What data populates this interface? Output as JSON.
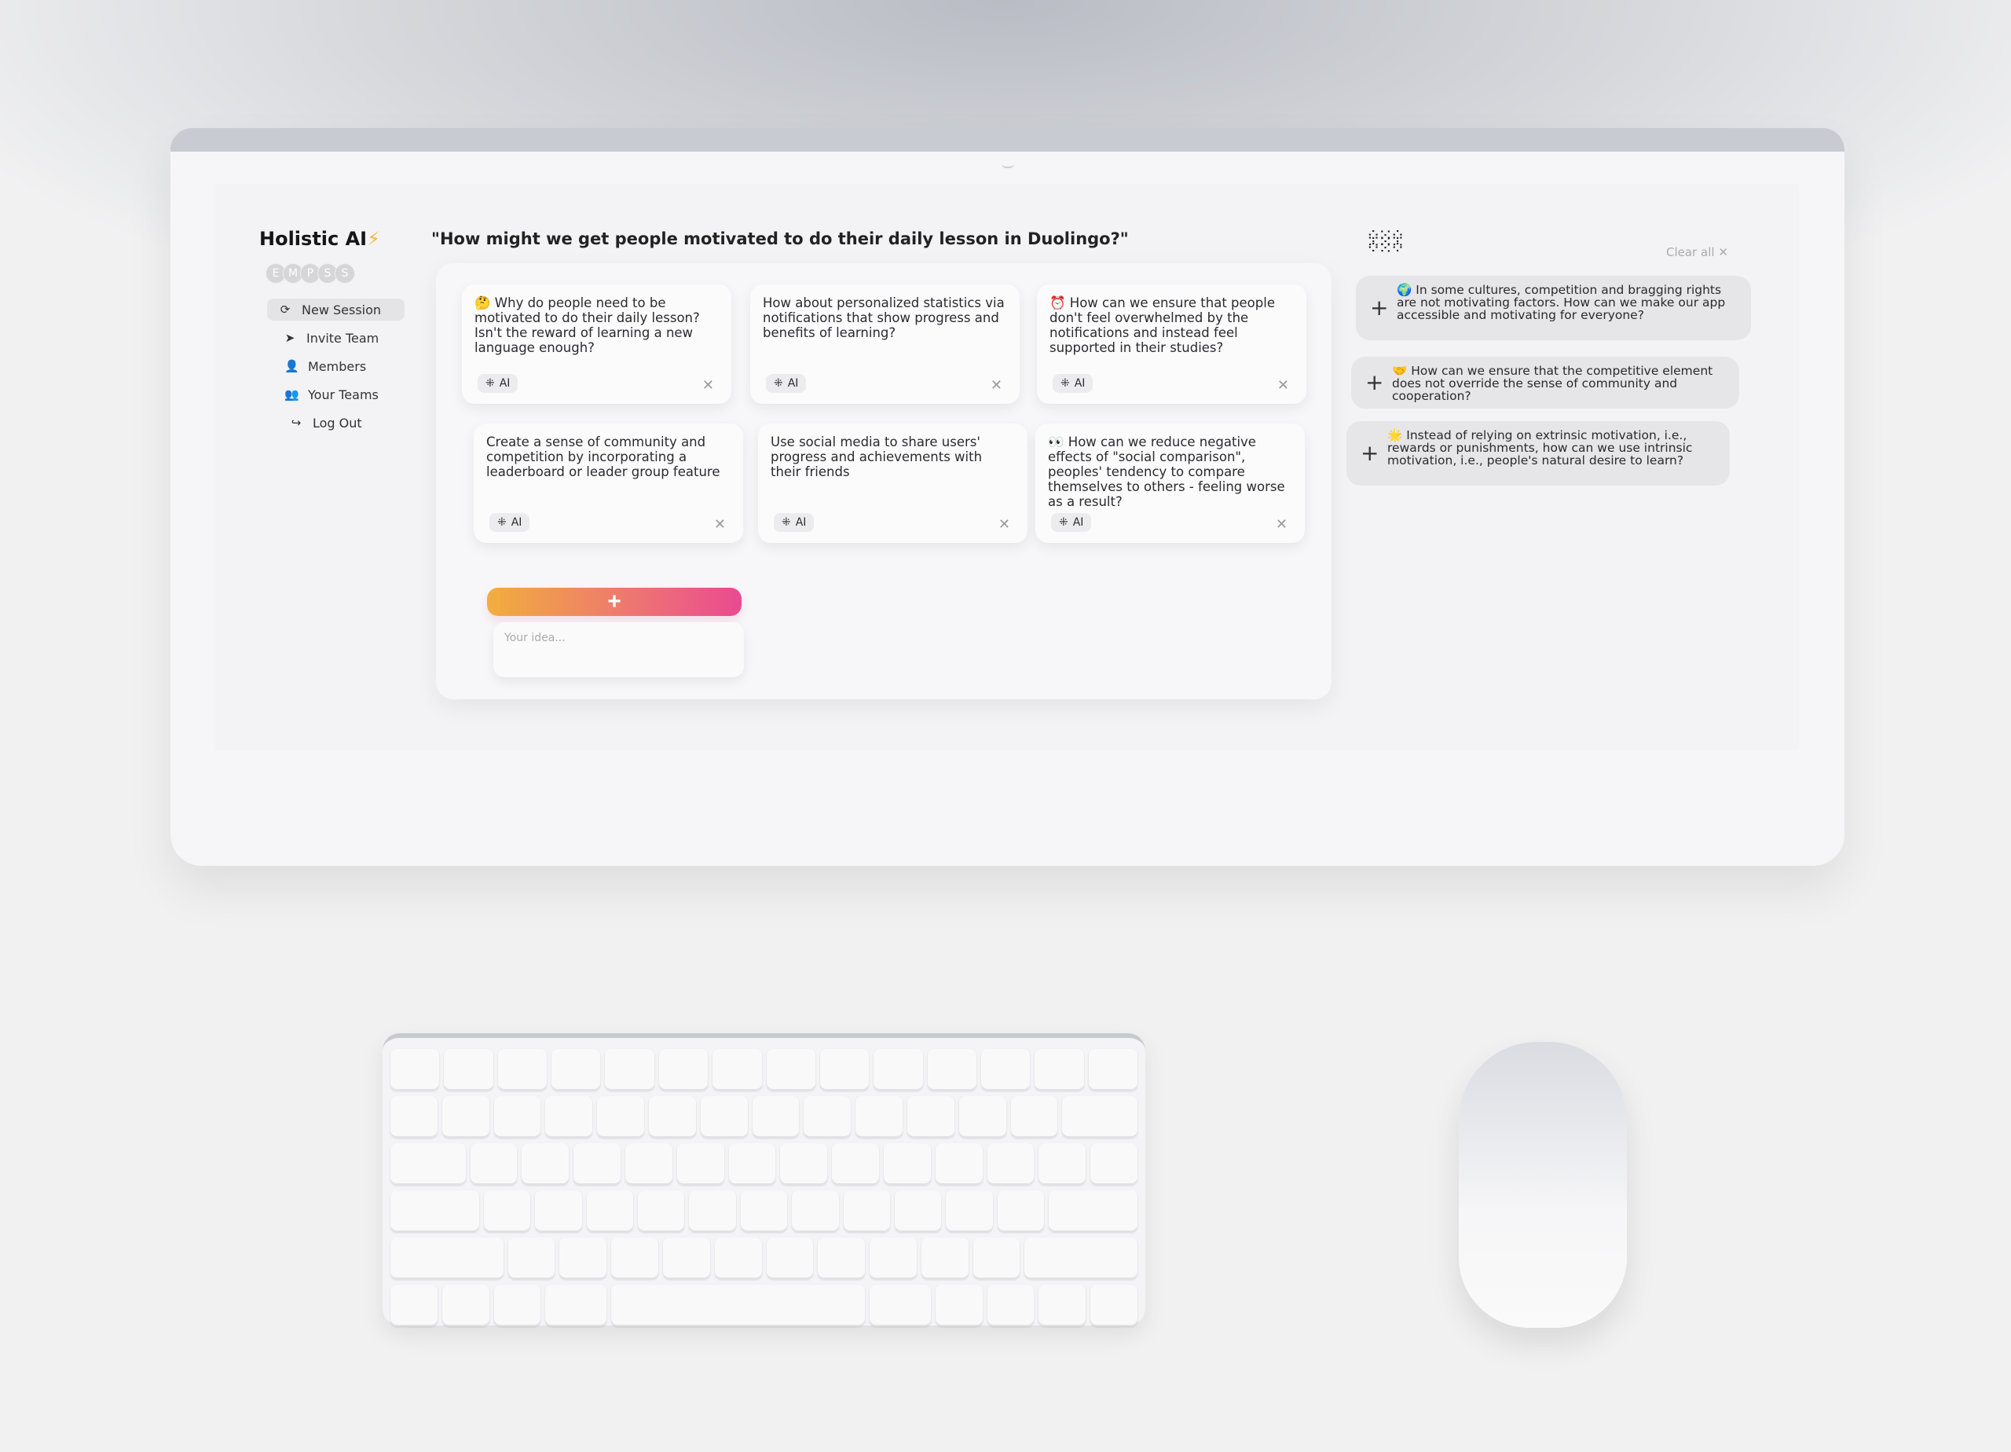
{
  "app": {
    "brand": "Holistic AI",
    "brand_icon": "lightning-bolt",
    "avatars": [
      "E",
      "M",
      "P",
      "S",
      "S"
    ]
  },
  "nav": [
    {
      "label": "New Session",
      "icon": "refresh",
      "active": true
    },
    {
      "label": "Invite Team",
      "icon": "paper-plane"
    },
    {
      "label": "Members",
      "icon": "user"
    },
    {
      "label": "Your Teams",
      "icon": "users"
    },
    {
      "label": "Log Out",
      "icon": "share-arrow"
    }
  ],
  "question": "\"How might we get people motivated to do their daily lesson in Duolingo?\"",
  "cards": [
    {
      "emoji": "🤔",
      "text": "Why do people need to be motivated to do their daily lesson? Isn't the reward of learning a new language enough?",
      "tag": "AI"
    },
    {
      "emoji": "",
      "text": "How about personalized statistics via notifications that show progress and benefits of learning?",
      "tag": "AI"
    },
    {
      "emoji": "⏰",
      "text": "How can we ensure that people don't feel overwhelmed by the notifications and instead feel supported in their studies?",
      "tag": "AI"
    },
    {
      "emoji": "",
      "text": "Create a sense of community and competition by incorporating a leaderboard or leader group feature",
      "tag": "AI"
    },
    {
      "emoji": "",
      "text": "Use social media to share users' progress and achievements with their friends",
      "tag": "AI"
    },
    {
      "emoji": "👀",
      "text": "How can we reduce negative effects of \"social comparison\", peoples' tendency to compare themselves to others - feeling worse as a result?",
      "tag": "AI"
    }
  ],
  "add": {
    "label": "+",
    "placeholder": "Your idea..."
  },
  "suggestions": {
    "clear_label": "Clear all",
    "items": [
      {
        "emoji": "🌍",
        "text": "In some cultures, competition and bragging rights are not motivating factors. How can we make our app accessible and motivating for everyone?"
      },
      {
        "emoji": "🤝",
        "text": "How can we ensure that the competitive element does not override the sense of community and cooperation?"
      },
      {
        "emoji": "🌟",
        "text": "Instead of relying on extrinsic motivation, i.e., rewards or punishments, how can we use intrinsic motivation, i.e., people's natural desire to learn?"
      }
    ]
  },
  "colors": {
    "gradient_start": "#f2ae3d",
    "gradient_end": "#ea4a92",
    "bolt": "#f4b73c"
  }
}
